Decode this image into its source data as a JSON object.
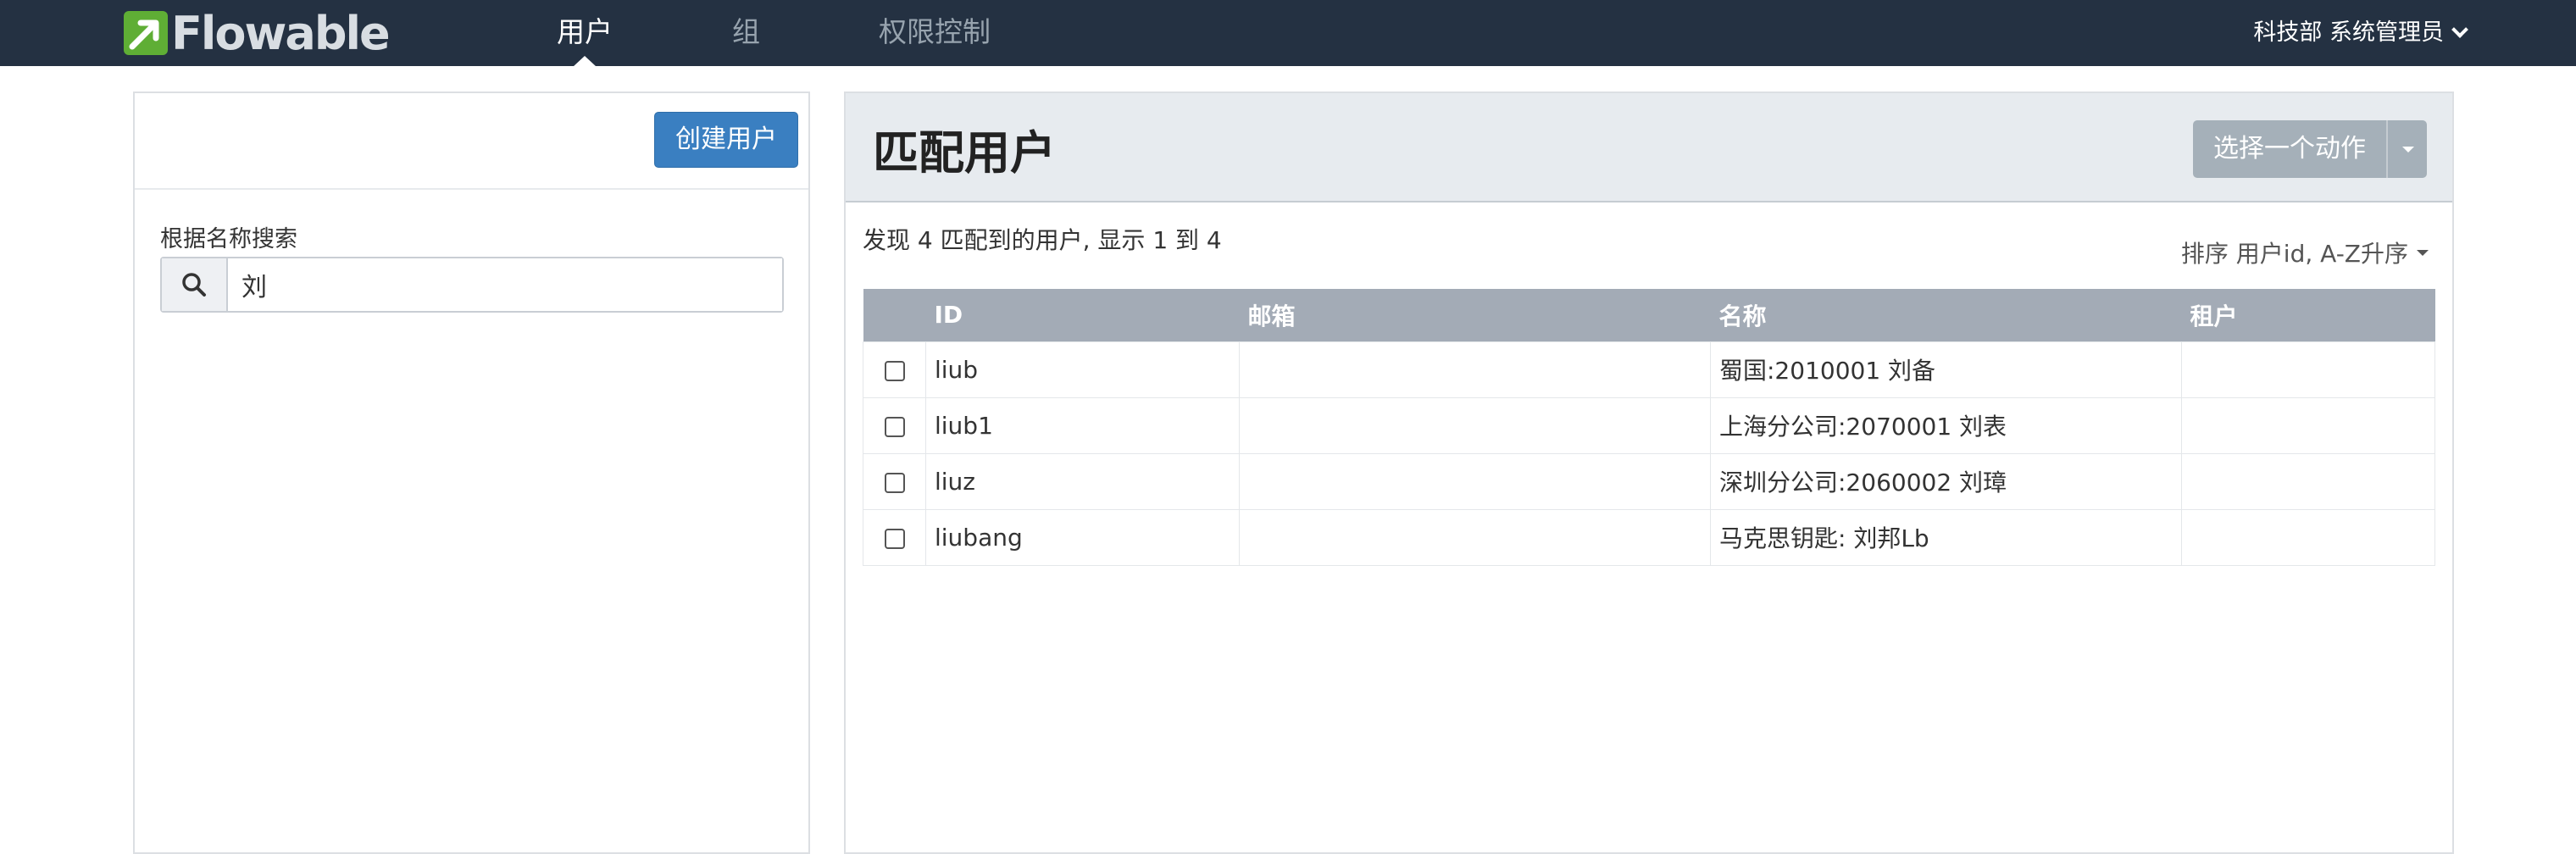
{
  "nav": {
    "brand": "Flowable",
    "items": [
      {
        "label": "用户"
      },
      {
        "label": "组"
      },
      {
        "label": "权限控制"
      }
    ],
    "user": "科技部 系统管理员"
  },
  "left": {
    "create_button": "创建用户",
    "search_label": "根据名称搜索",
    "search_value": "刘"
  },
  "right": {
    "title": "匹配用户",
    "action_button": "选择一个动作",
    "result_text": "发现 4 匹配到的用户, 显示 1 到 4",
    "sort_text": "排序 用户id, A-Z升序",
    "columns": [
      "ID",
      "邮箱",
      "名称",
      "租户"
    ],
    "rows": [
      {
        "id": "liub",
        "email": "",
        "name": "蜀国:2010001 刘备",
        "tenant": ""
      },
      {
        "id": "liub1",
        "email": "",
        "name": "上海分公司:2070001 刘表",
        "tenant": ""
      },
      {
        "id": "liuz",
        "email": "",
        "name": "深圳分公司:2060002 刘璋",
        "tenant": ""
      },
      {
        "id": "liubang",
        "email": "",
        "name": "马克思钥匙: 刘邦Lb",
        "tenant": ""
      }
    ]
  },
  "colors": {
    "navbar": "#243142",
    "primary": "#3a7fc1",
    "brand_green": "#5fae35",
    "table_header": "#a3abb6"
  }
}
